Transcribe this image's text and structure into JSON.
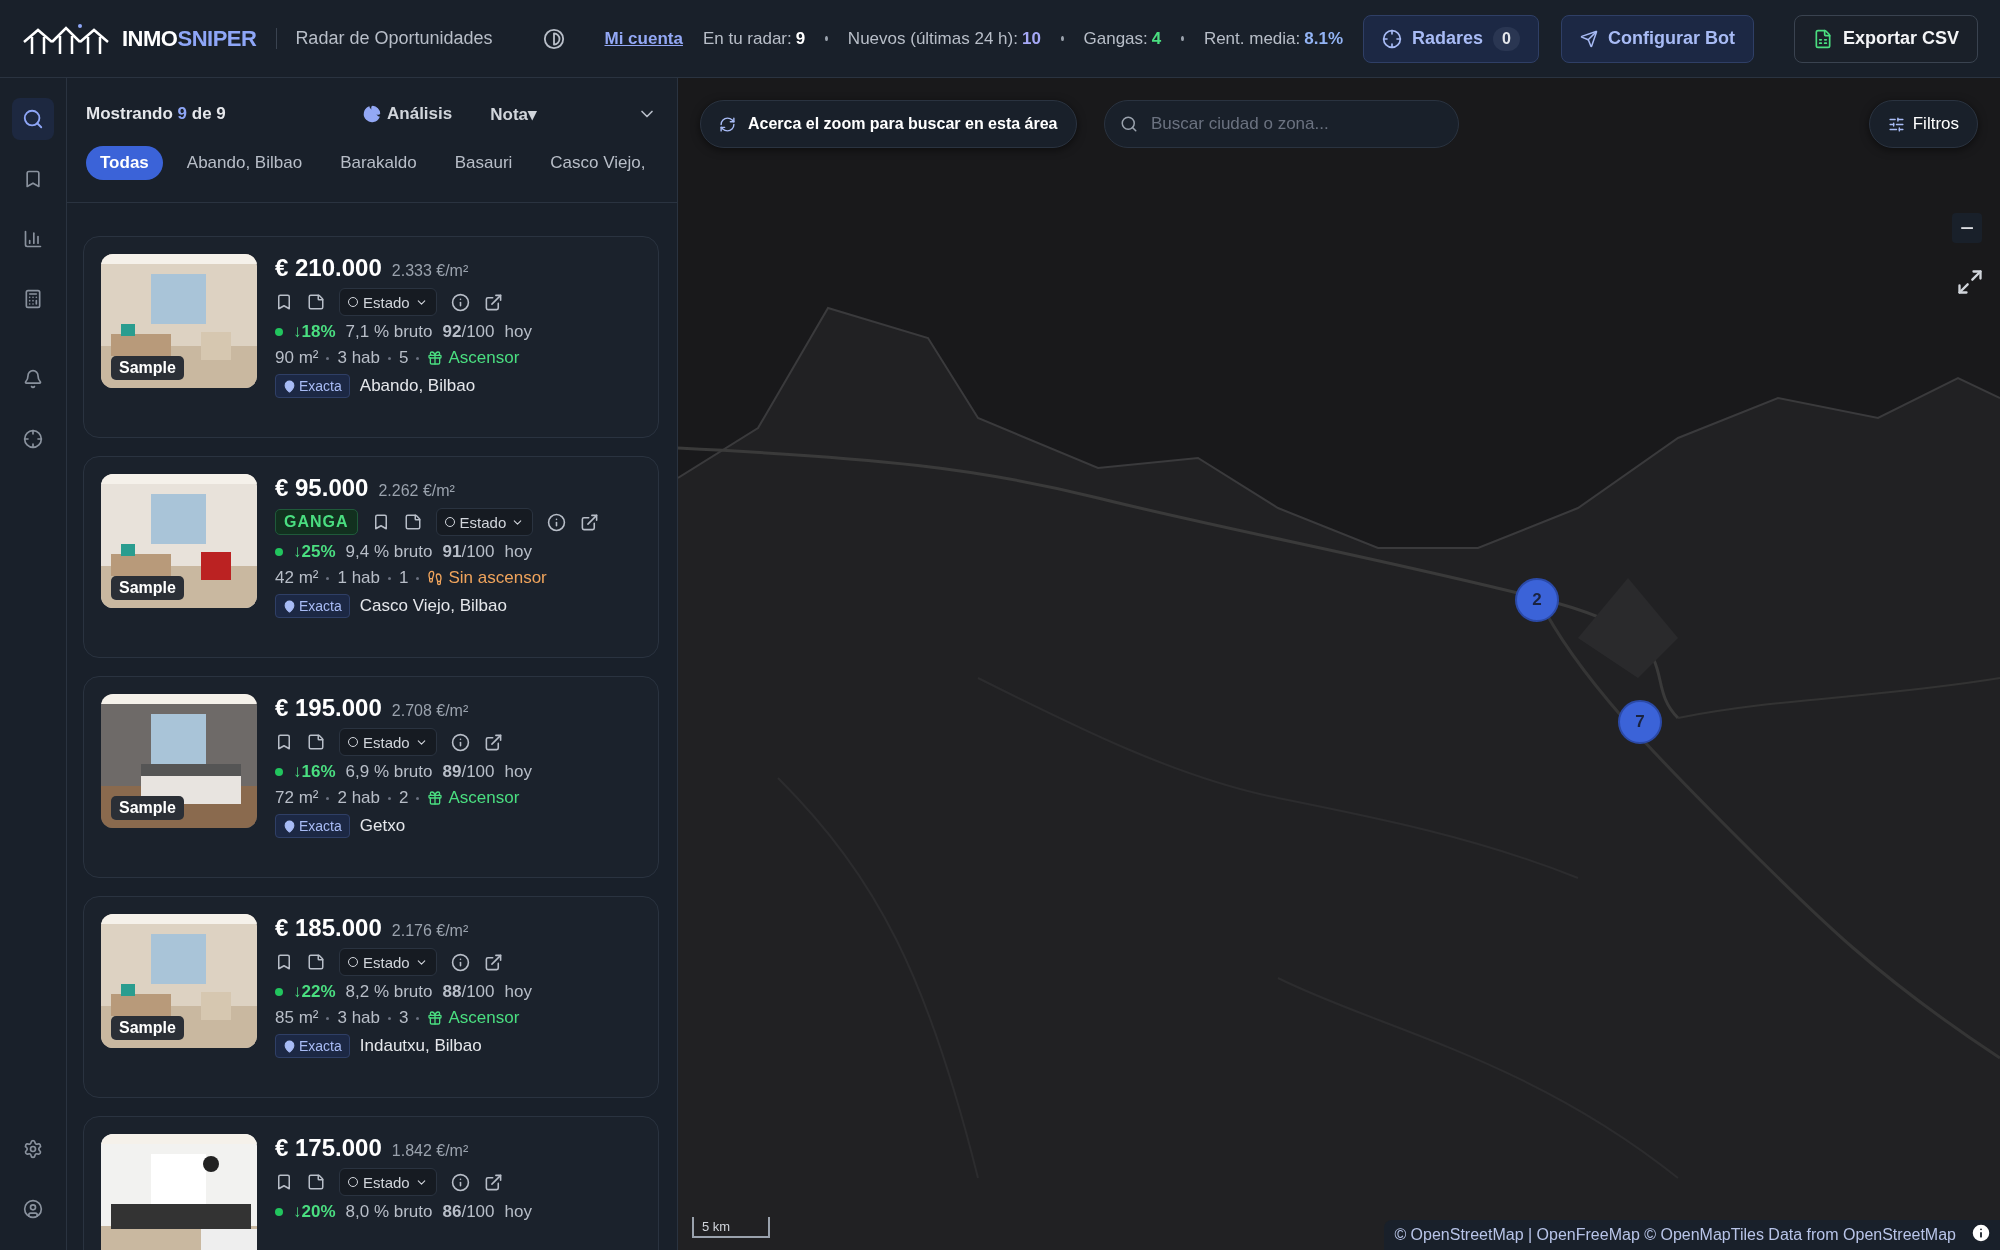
{
  "header": {
    "brand_a": "INMO",
    "brand_b": "SNIPER",
    "subtitle": "Radar de Oportunidades",
    "account_link": "Mi cuenta",
    "stats": [
      {
        "label": "En tu radar:",
        "value": "9",
        "color": "#ffffff"
      },
      {
        "label": "Nuevos (últimas 24 h):",
        "value": "10",
        "color": "#a5a8f5"
      },
      {
        "label": "Gangas:",
        "value": "4",
        "color": "#4ade80"
      },
      {
        "label": "Rent. media:",
        "value": "8.1%",
        "color": "#93b4f5"
      }
    ],
    "radar_button": {
      "label": "Radares",
      "count": "0"
    },
    "bot_button": "Configurar Bot",
    "export_button": "Exportar CSV"
  },
  "rail": {
    "items": [
      {
        "kind": "search",
        "selected": true
      },
      {
        "kind": "bookmark",
        "selected": false
      },
      {
        "kind": "chart",
        "selected": false
      },
      {
        "kind": "calculator",
        "selected": false
      },
      {
        "kind": "bell",
        "selected": false
      },
      {
        "kind": "target",
        "selected": false
      }
    ],
    "bottom": [
      {
        "kind": "settings"
      },
      {
        "kind": "user"
      }
    ]
  },
  "list": {
    "summary": "Mostrando *9* de 9",
    "analysis": "Análisis",
    "sort": "Nota▾",
    "filters": [
      {
        "label": "Todas",
        "selected": true
      },
      {
        "label": "Abando, Bilbao",
        "selected": false
      },
      {
        "label": "Barakaldo",
        "selected": false
      },
      {
        "label": "Basauri",
        "selected": false
      },
      {
        "label": "Casco Viejo,",
        "selected": false
      }
    ],
    "cards": [
      {
        "price": "€ 210.000",
        "ppm": "2.333 €/m²",
        "ganga": false,
        "status": "Estado",
        "drop": "↓18%",
        "yield": "7,1 % bruto",
        "score": "**92**/100",
        "when": "hoy",
        "area": "90 m²",
        "rooms": "3 hab",
        "floor": "5",
        "elevator": {
          "kind": "yes",
          "label": "Ascensor"
        },
        "precision": "Exacta",
        "location": "Abando, Bilbao",
        "sample": "Sample"
      },
      {
        "price": "€ 95.000",
        "ppm": "2.262 €/m²",
        "ganga": true,
        "ganga_label": "GANGA",
        "status": "Estado",
        "drop": "↓25%",
        "yield": "9,4 % bruto",
        "score": "**91**/100",
        "when": "hoy",
        "area": "42 m²",
        "rooms": "1 hab",
        "floor": "1",
        "elevator": {
          "kind": "no",
          "label": "Sin ascensor"
        },
        "precision": "Exacta",
        "location": "Casco Viejo, Bilbao",
        "sample": "Sample"
      },
      {
        "price": "€ 195.000",
        "ppm": "2.708 €/m²",
        "ganga": false,
        "status": "Estado",
        "drop": "↓16%",
        "yield": "6,9 % bruto",
        "score": "**89**/100",
        "when": "hoy",
        "area": "72 m²",
        "rooms": "2 hab",
        "floor": "2",
        "elevator": {
          "kind": "yes",
          "label": "Ascensor"
        },
        "precision": "Exacta",
        "location": "Getxo",
        "sample": "Sample"
      },
      {
        "price": "€ 185.000",
        "ppm": "2.176 €/m²",
        "ganga": false,
        "status": "Estado",
        "drop": "↓22%",
        "yield": "8,2 % bruto",
        "score": "**88**/100",
        "when": "hoy",
        "area": "85 m²",
        "rooms": "3 hab",
        "floor": "3",
        "elevator": {
          "kind": "yes",
          "label": "Ascensor"
        },
        "precision": "Exacta",
        "location": "Indautxu, Bilbao",
        "sample": "Sample"
      },
      {
        "price": "€ 175.000",
        "ppm": "1.842 €/m²",
        "ganga": false,
        "status": "Estado",
        "drop": "↓20%",
        "yield": "8,0 % bruto",
        "score": "**86**/100",
        "when": "hoy"
      }
    ]
  },
  "map": {
    "zoom_hint": "Acerca el zoom para buscar en esta área",
    "search_placeholder": "Buscar ciudad o zona...",
    "filters_button": "Filtros",
    "zoom_out": "−",
    "clusters": [
      {
        "count": "2"
      },
      {
        "count": "7"
      }
    ],
    "scale": "5 km",
    "attribution": "© OpenStreetMap | OpenFreeMap © OpenMapTiles Data from OpenStreetMap"
  }
}
